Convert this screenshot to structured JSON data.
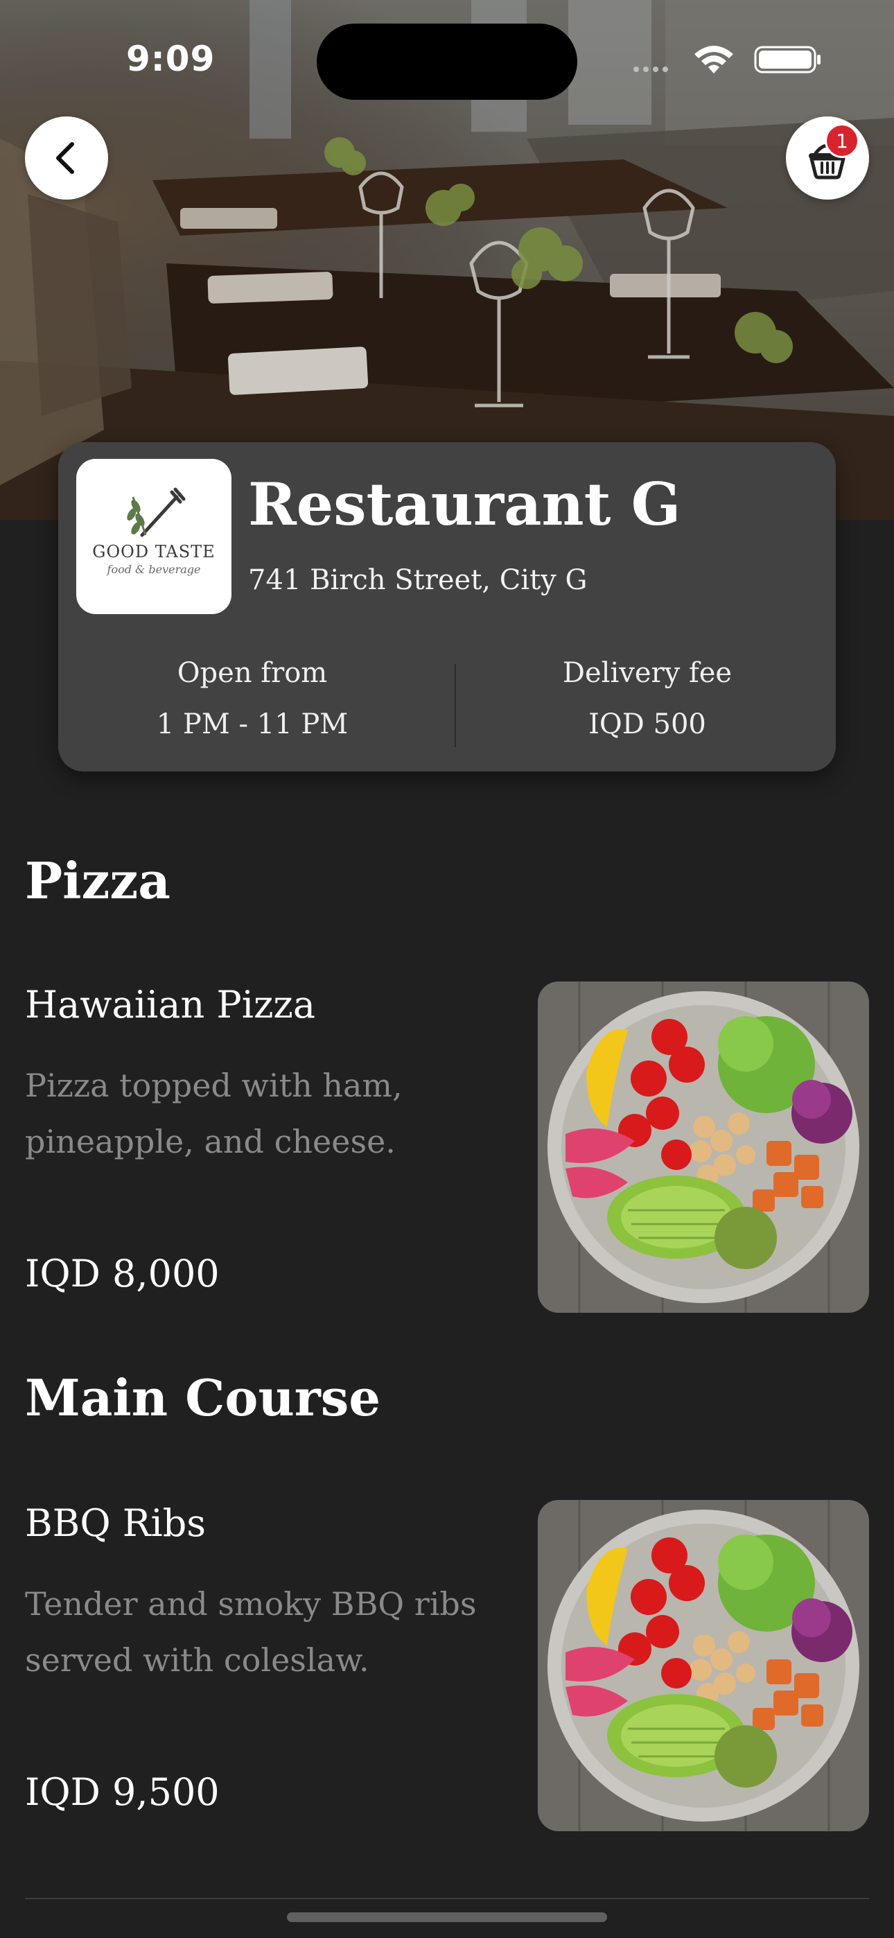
{
  "status_bar": {
    "time": "9:09"
  },
  "header": {
    "cart_count": "1"
  },
  "restaurant": {
    "name": "Restaurant G",
    "address": "741 Birch Street, City G",
    "logo": {
      "name": "GOOD TASTE",
      "tagline": "food & beverage"
    },
    "open_label": "Open from",
    "open_hours": "1 PM - 11 PM",
    "fee_label": "Delivery fee",
    "fee_value": "IQD 500"
  },
  "sections": [
    {
      "title": "Pizza",
      "items": [
        {
          "name": "Hawaiian Pizza",
          "description": "Pizza topped with ham, pineapple, and cheese.",
          "price": "IQD 8,000"
        }
      ]
    },
    {
      "title": "Main Course",
      "items": [
        {
          "name": "BBQ Ribs",
          "description": "Tender and smoky BBQ ribs served with coleslaw.",
          "price": "IQD 9,500"
        }
      ]
    }
  ],
  "icons": {
    "back": "chevron-left-icon",
    "cart": "basket-icon",
    "signal": "cellular-icon",
    "wifi": "wifi-icon",
    "battery": "battery-icon"
  }
}
